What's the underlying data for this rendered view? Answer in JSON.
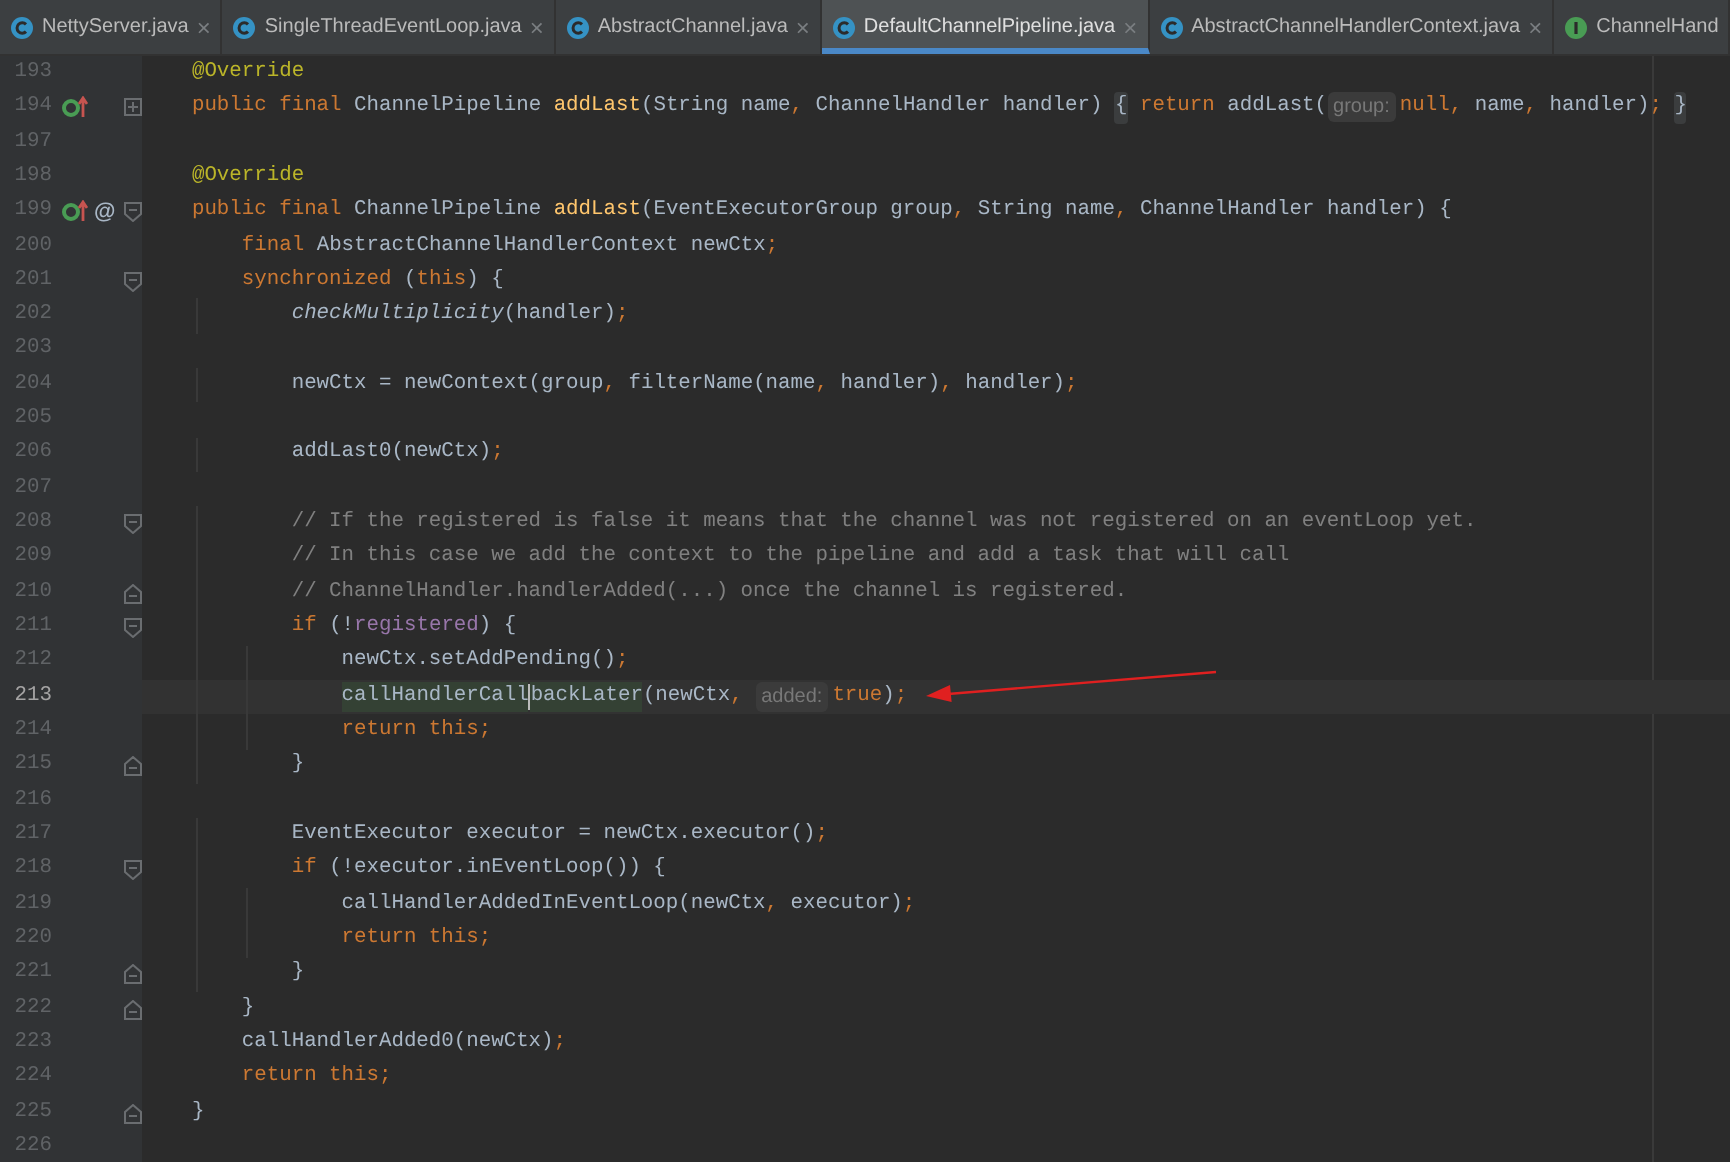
{
  "tabs": [
    {
      "label": "NettyServer.java",
      "kind": "class",
      "selected": false,
      "closable": true
    },
    {
      "label": "SingleThreadEventLoop.java",
      "kind": "class",
      "selected": false,
      "closable": true
    },
    {
      "label": "AbstractChannel.java",
      "kind": "class",
      "selected": false,
      "closable": true
    },
    {
      "label": "DefaultChannelPipeline.java",
      "kind": "class",
      "selected": true,
      "closable": true
    },
    {
      "label": "AbstractChannelHandlerContext.java",
      "kind": "class",
      "selected": false,
      "closable": true
    },
    {
      "label": "ChannelHand",
      "kind": "interface",
      "selected": false,
      "closable": false
    }
  ],
  "close_glyph": "×",
  "lines": [
    {
      "number": "193",
      "tokens": [
        {
          "text": "    @Override",
          "kind": "annotation"
        }
      ]
    },
    {
      "number": "194",
      "override": true,
      "folded": true,
      "tokens": [
        {
          "text": "    public final",
          "kind": "keyword"
        },
        {
          "text": " ChannelPipeline ",
          "kind": "plain"
        },
        {
          "text": "addLast",
          "kind": "method"
        },
        {
          "text": "(String name",
          "kind": "plain"
        },
        {
          "text": ",",
          "kind": "punct"
        },
        {
          "text": " ChannelHandler handler) ",
          "kind": "plain"
        },
        {
          "text": "{",
          "kind": "fold_brace"
        },
        {
          "text": " return",
          "kind": "keyword"
        },
        {
          "text": " addLast(",
          "kind": "plain"
        },
        {
          "text": "group:",
          "kind": "hint"
        },
        {
          "text": "null",
          "kind": "keyword"
        },
        {
          "text": ",",
          "kind": "punct"
        },
        {
          "text": " name",
          "kind": "plain"
        },
        {
          "text": ",",
          "kind": "punct"
        },
        {
          "text": " handler)",
          "kind": "plain"
        },
        {
          "text": ";",
          "kind": "punct"
        },
        {
          "text": " }",
          "kind": "fold_brace"
        }
      ]
    },
    {
      "number": "197"
    },
    {
      "number": "198",
      "tokens": [
        {
          "text": "    @Override",
          "kind": "annotation"
        }
      ]
    },
    {
      "number": "199",
      "override": true,
      "badge": "@",
      "fold_start": true,
      "tokens": [
        {
          "text": "    public final",
          "kind": "keyword"
        },
        {
          "text": " ChannelPipeline ",
          "kind": "plain"
        },
        {
          "text": "addLast",
          "kind": "method"
        },
        {
          "text": "(EventExecutorGroup group",
          "kind": "plain"
        },
        {
          "text": ",",
          "kind": "punct"
        },
        {
          "text": " String name",
          "kind": "plain"
        },
        {
          "text": ",",
          "kind": "punct"
        },
        {
          "text": " ChannelHandler handler) {",
          "kind": "plain"
        }
      ]
    },
    {
      "number": "200",
      "tokens": [
        {
          "text": "        final",
          "kind": "keyword"
        },
        {
          "text": " AbstractChannelHandlerContext newCtx",
          "kind": "plain"
        },
        {
          "text": ";",
          "kind": "punct"
        }
      ]
    },
    {
      "number": "201",
      "fold_start": true,
      "tokens": [
        {
          "text": "        synchronized",
          "kind": "keyword"
        },
        {
          "text": " (",
          "kind": "plain"
        },
        {
          "text": "this",
          "kind": "keyword"
        },
        {
          "text": ") {",
          "kind": "plain"
        }
      ]
    },
    {
      "number": "202",
      "tokens": [
        {
          "text": "            checkMultiplicity",
          "kind": "static"
        },
        {
          "text": "(handler)",
          "kind": "plain"
        },
        {
          "text": ";",
          "kind": "punct"
        }
      ]
    },
    {
      "number": "203"
    },
    {
      "number": "204",
      "tokens": [
        {
          "text": "            newCtx = newContext(group",
          "kind": "plain"
        },
        {
          "text": ",",
          "kind": "punct"
        },
        {
          "text": " filterName(name",
          "kind": "plain"
        },
        {
          "text": ",",
          "kind": "punct"
        },
        {
          "text": " handler)",
          "kind": "plain"
        },
        {
          "text": ",",
          "kind": "punct"
        },
        {
          "text": " handler)",
          "kind": "plain"
        },
        {
          "text": ";",
          "kind": "punct"
        }
      ]
    },
    {
      "number": "205"
    },
    {
      "number": "206",
      "tokens": [
        {
          "text": "            addLast0(newCtx)",
          "kind": "plain"
        },
        {
          "text": ";",
          "kind": "punct"
        }
      ]
    },
    {
      "number": "207"
    },
    {
      "number": "208",
      "fold_start": true,
      "tokens": [
        {
          "text": "            // If the registered is false it means that the channel was not registered on an eventLoop yet.",
          "kind": "comment"
        }
      ]
    },
    {
      "number": "209",
      "tokens": [
        {
          "text": "            // In this case we add the context to the pipeline and add a task that will call",
          "kind": "comment"
        }
      ]
    },
    {
      "number": "210",
      "fold_end": true,
      "tokens": [
        {
          "text": "            // ChannelHandler.handlerAdded(...) once the channel is registered.",
          "kind": "comment"
        }
      ]
    },
    {
      "number": "211",
      "fold_start": true,
      "tokens": [
        {
          "text": "            if",
          "kind": "keyword"
        },
        {
          "text": " (!",
          "kind": "plain"
        },
        {
          "text": "registered",
          "kind": "field"
        },
        {
          "text": ") {",
          "kind": "plain"
        }
      ]
    },
    {
      "number": "212",
      "tokens": [
        {
          "text": "                newCtx.setAddPending()",
          "kind": "plain"
        },
        {
          "text": ";",
          "kind": "punct"
        }
      ]
    },
    {
      "number": "213",
      "current": true,
      "tokens": [
        {
          "text": "                callHandlerCall",
          "kind": "usage"
        },
        {
          "text": "backLater",
          "kind": "usage",
          "caret_before": true
        },
        {
          "text": "(newCtx",
          "kind": "plain"
        },
        {
          "text": ", ",
          "kind": "punct"
        },
        {
          "text": "added:",
          "kind": "hint"
        },
        {
          "text": "true",
          "kind": "keyword"
        },
        {
          "text": ")",
          "kind": "plain"
        },
        {
          "text": ";",
          "kind": "punct"
        }
      ]
    },
    {
      "number": "214",
      "tokens": [
        {
          "text": "                return this",
          "kind": "keyword"
        },
        {
          "text": ";",
          "kind": "punct"
        }
      ]
    },
    {
      "number": "215",
      "fold_end": true,
      "tokens": [
        {
          "text": "            }",
          "kind": "plain"
        }
      ]
    },
    {
      "number": "216"
    },
    {
      "number": "217",
      "tokens": [
        {
          "text": "            EventExecutor executor = newCtx.executor()",
          "kind": "plain"
        },
        {
          "text": ";",
          "kind": "punct"
        }
      ]
    },
    {
      "number": "218",
      "fold_start": true,
      "tokens": [
        {
          "text": "            if",
          "kind": "keyword"
        },
        {
          "text": " (!executor.inEventLoop()) {",
          "kind": "plain"
        }
      ]
    },
    {
      "number": "219",
      "tokens": [
        {
          "text": "                callHandlerAddedInEventLoop(newCtx",
          "kind": "plain"
        },
        {
          "text": ",",
          "kind": "punct"
        },
        {
          "text": " executor)",
          "kind": "plain"
        },
        {
          "text": ";",
          "kind": "punct"
        }
      ]
    },
    {
      "number": "220",
      "tokens": [
        {
          "text": "                return this",
          "kind": "keyword"
        },
        {
          "text": ";",
          "kind": "punct"
        }
      ]
    },
    {
      "number": "221",
      "fold_end": true,
      "tokens": [
        {
          "text": "            }",
          "kind": "plain"
        }
      ]
    },
    {
      "number": "222",
      "fold_end": true,
      "tokens": [
        {
          "text": "        }",
          "kind": "plain"
        }
      ]
    },
    {
      "number": "223",
      "tokens": [
        {
          "text": "        callHandlerAdded0(newCtx)",
          "kind": "plain"
        },
        {
          "text": ";",
          "kind": "punct"
        }
      ]
    },
    {
      "number": "224",
      "tokens": [
        {
          "text": "        return this",
          "kind": "keyword"
        },
        {
          "text": ";",
          "kind": "punct"
        }
      ]
    },
    {
      "number": "225",
      "fold_end": true,
      "tokens": [
        {
          "text": "    }",
          "kind": "plain"
        }
      ]
    },
    {
      "number": "226"
    }
  ]
}
